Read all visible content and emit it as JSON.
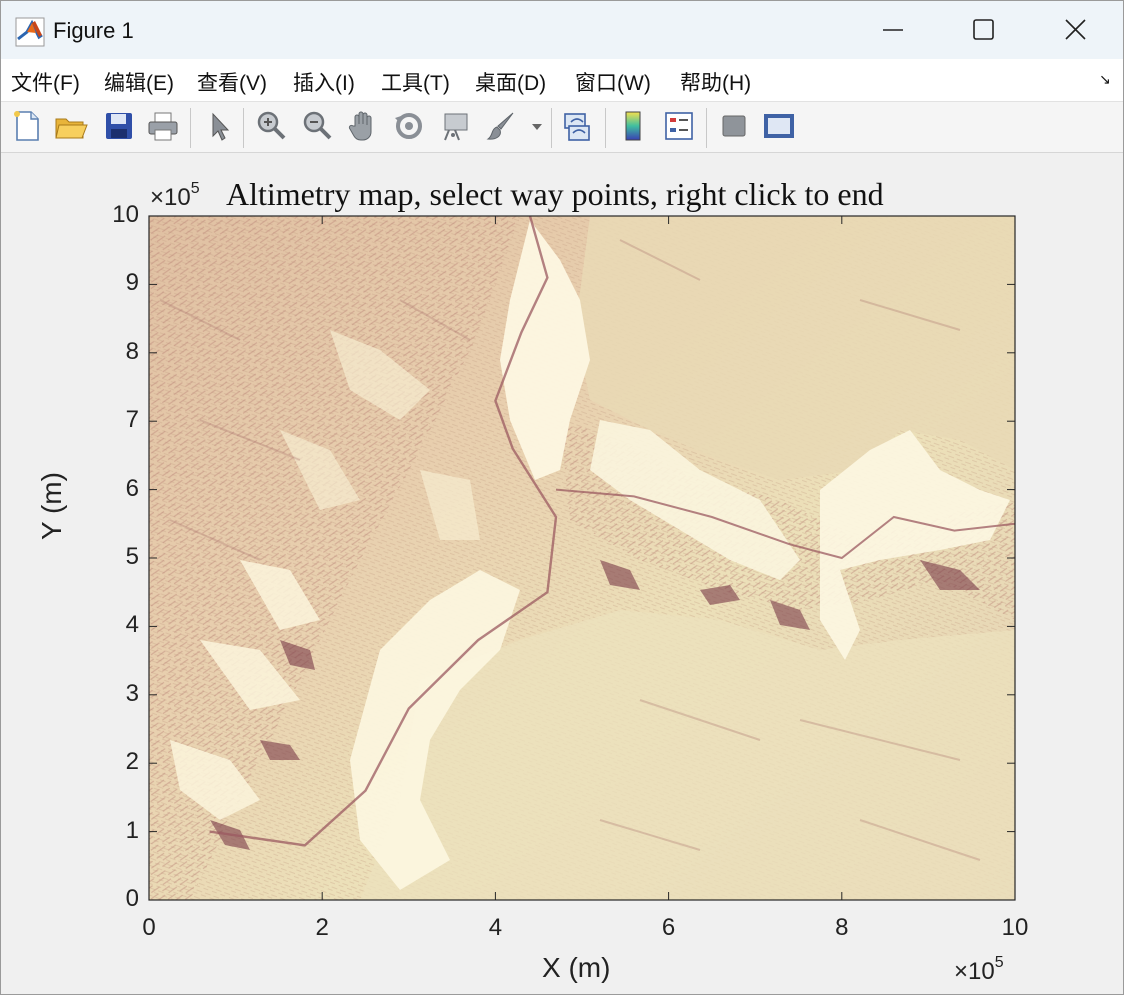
{
  "window": {
    "title": "Figure 1",
    "icon": "matlab-icon",
    "controls": [
      "minimize-icon",
      "maximize-icon",
      "close-icon"
    ]
  },
  "menu": {
    "items": [
      "文件(F)",
      "编辑(E)",
      "查看(V)",
      "插入(I)",
      "工具(T)",
      "桌面(D)",
      "窗口(W)",
      "帮助(H)"
    ],
    "dock_glyph": "↘"
  },
  "toolbar": {
    "buttons": [
      "new-figure",
      "open-file",
      "save",
      "print",
      "edit-plot",
      "zoom-in",
      "zoom-out",
      "pan",
      "rotate-3d",
      "data-cursor",
      "brush",
      "brush-dropdown",
      "link-plot",
      "insert-colorbar",
      "insert-legend",
      "hide-plot-tools",
      "show-plot-tools"
    ]
  },
  "plot": {
    "title": "Altimetry map, select way points, right click to end",
    "xlabel": "X (m)",
    "ylabel": "Y (m)",
    "x_exponent_base": "×10",
    "x_exponent": "5",
    "y_exponent_base": "×10",
    "y_exponent": "5",
    "x_ticks": [
      "0",
      "2",
      "4",
      "6",
      "8",
      "10"
    ],
    "y_ticks": [
      "0",
      "1",
      "2",
      "3",
      "4",
      "5",
      "6",
      "7",
      "8",
      "9",
      "10"
    ],
    "colormap": [
      "#f3ebc5",
      "#e6cda7",
      "#c9998e",
      "#8e4f5e"
    ],
    "plateau_color": "#eadcb3",
    "highlight_color": "#fffbe8"
  },
  "chart_data": {
    "type": "heatmap",
    "title": "Altimetry map, select way points, right click to end",
    "xlabel": "X (m)",
    "ylabel": "Y (m)",
    "xlim": [
      0,
      1000000
    ],
    "ylim": [
      0,
      1000000
    ],
    "x_ticks": [
      0,
      200000,
      400000,
      600000,
      800000,
      1000000
    ],
    "y_ticks": [
      0,
      100000,
      200000,
      300000,
      400000,
      500000,
      600000,
      700000,
      800000,
      900000,
      1000000
    ],
    "river_path": [
      [
        70000,
        100000
      ],
      [
        180000,
        80000
      ],
      [
        250000,
        160000
      ],
      [
        300000,
        280000
      ],
      [
        380000,
        380000
      ],
      [
        460000,
        450000
      ],
      [
        470000,
        560000
      ],
      [
        420000,
        660000
      ],
      [
        400000,
        730000
      ],
      [
        430000,
        830000
      ],
      [
        460000,
        910000
      ],
      [
        440000,
        1000000
      ]
    ],
    "side_canyon": [
      [
        470000,
        600000
      ],
      [
        560000,
        590000
      ],
      [
        650000,
        560000
      ],
      [
        740000,
        520000
      ],
      [
        800000,
        500000
      ],
      [
        860000,
        560000
      ],
      [
        930000,
        540000
      ],
      [
        1000000,
        550000
      ]
    ]
  }
}
